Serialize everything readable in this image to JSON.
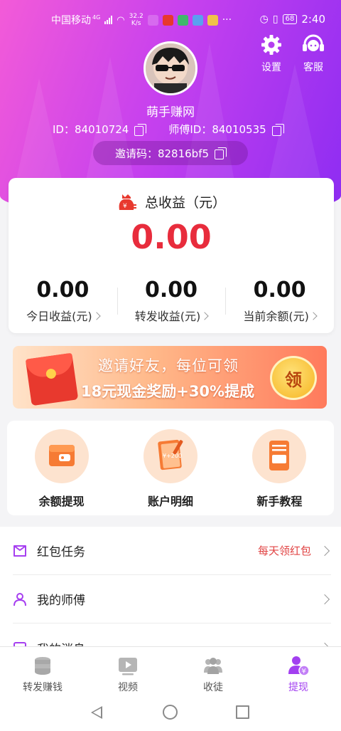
{
  "status_bar": {
    "carrier": "中国移动",
    "network": "4G",
    "speed_value": "32.2",
    "speed_unit": "K/s",
    "battery": "68",
    "time": "2:40"
  },
  "header": {
    "settings_label": "设置",
    "service_label": "客服",
    "nickname": "萌手赚网",
    "id_label": "ID：",
    "id_value": "84010724",
    "master_label": "师傅ID：",
    "master_value": "84010535",
    "invite_label": "邀请码：",
    "invite_value": "82816bf5"
  },
  "earnings": {
    "title": "总收益（元）",
    "total": "0.00",
    "items": [
      {
        "value": "0.00",
        "label": "今日收益(元)"
      },
      {
        "value": "0.00",
        "label": "转发收益(元)"
      },
      {
        "value": "0.00",
        "label": "当前余额(元)"
      }
    ]
  },
  "banner": {
    "line1": "邀请好友，每位可领",
    "line2": "18元现金奖励+30%提成",
    "claim": "领"
  },
  "quick_actions": [
    {
      "label": "余额提现",
      "icon": "wallet-icon"
    },
    {
      "label": "账户明细",
      "icon": "ledger-icon",
      "icon_text": "¥+200"
    },
    {
      "label": "新手教程",
      "icon": "tutorial-icon"
    }
  ],
  "list": [
    {
      "label": "红包任务",
      "extra": "每天领红包",
      "icon": "task-icon"
    },
    {
      "label": "我的师傅",
      "extra": "",
      "icon": "person-icon"
    },
    {
      "label": "我的消息",
      "extra": "",
      "icon": "message-icon"
    }
  ],
  "tabs": [
    {
      "label": "转发赚钱",
      "icon": "coins-icon"
    },
    {
      "label": "视频",
      "icon": "video-icon"
    },
    {
      "label": "收徒",
      "icon": "apprentice-icon"
    },
    {
      "label": "提现",
      "icon": "withdraw-icon",
      "active": true
    }
  ],
  "colors": {
    "accent": "#a23ff0",
    "total_red": "#e82c3c",
    "header_gradient_start": "#f35bd8",
    "header_gradient_end": "#8d2cf2"
  }
}
